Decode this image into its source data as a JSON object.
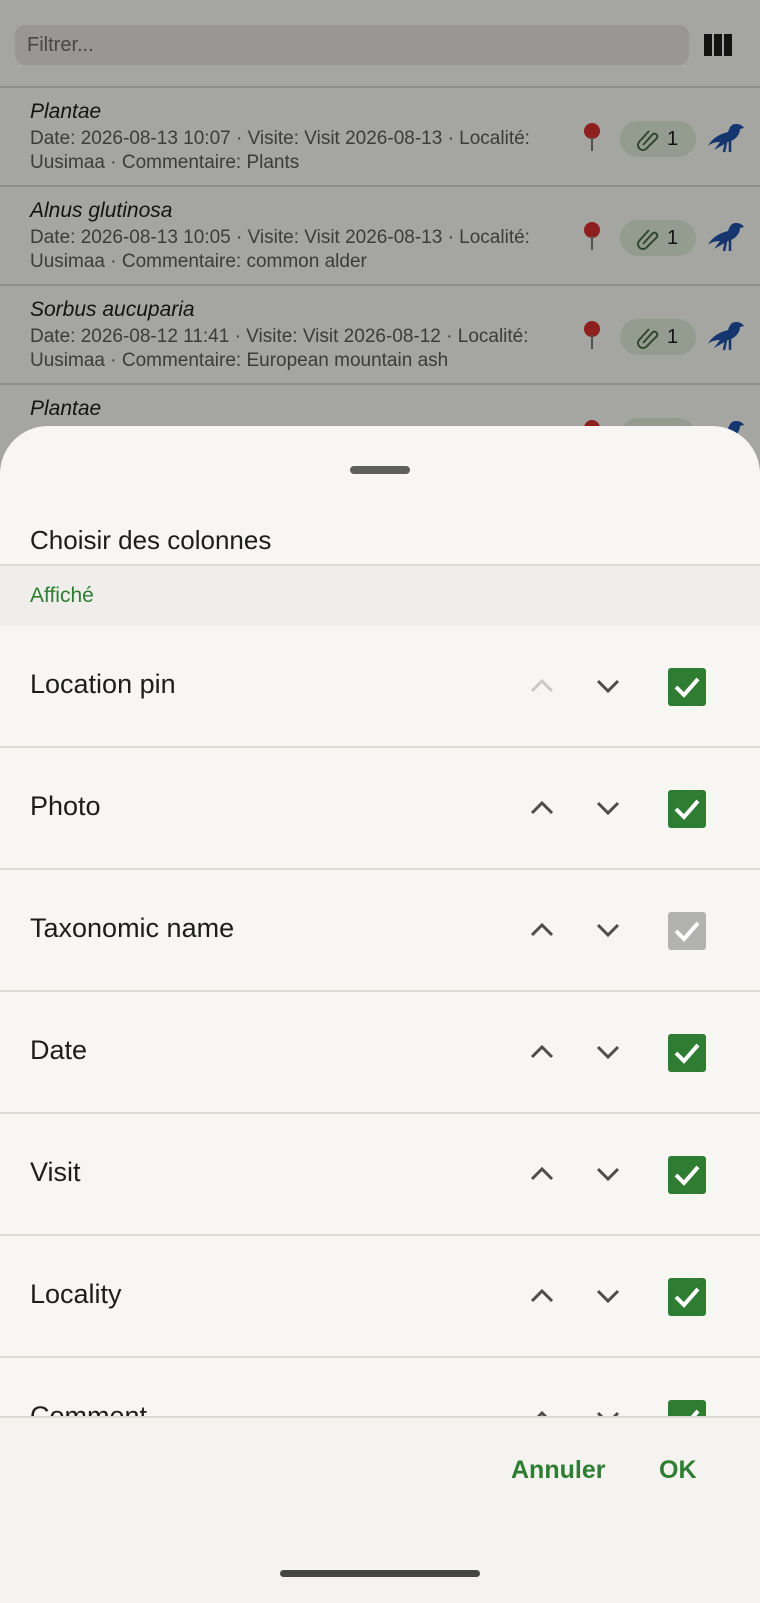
{
  "filter": {
    "placeholder": "Filtrer..."
  },
  "observations": [
    {
      "name": "Plantae",
      "line1": "Date: 2026-08-13 10:07  ·  Visite: Visit 2026-08-13  ·  Localité:",
      "line2": "Uusimaa  ·  Commentaire: Plants",
      "attachments": "1"
    },
    {
      "name": "Alnus glutinosa",
      "line1": "Date: 2026-08-13 10:05  ·  Visite: Visit 2026-08-13  ·  Localité:",
      "line2": "Uusimaa  ·  Commentaire: common alder",
      "attachments": "1"
    },
    {
      "name": "Sorbus aucuparia",
      "line1": "Date: 2026-08-12 11:41  ·  Visite: Visit 2026-08-12  ·  Localité:",
      "line2": "Uusimaa  ·  Commentaire: European mountain ash",
      "attachments": "1"
    },
    {
      "name": "Plantae",
      "line1": "",
      "line2": "",
      "attachments": ""
    }
  ],
  "dialog": {
    "title": "Choisir des colonnes",
    "section": "Affiché",
    "columns": [
      {
        "label": "Location pin",
        "checked": true,
        "up_enabled": false
      },
      {
        "label": "Photo",
        "checked": true,
        "up_enabled": true
      },
      {
        "label": "Taxonomic name",
        "checked": true,
        "disabled": true,
        "up_enabled": true
      },
      {
        "label": "Date",
        "checked": true,
        "up_enabled": true
      },
      {
        "label": "Visit",
        "checked": true,
        "up_enabled": true
      },
      {
        "label": "Locality",
        "checked": true,
        "up_enabled": true
      },
      {
        "label": "Comment",
        "checked": true,
        "up_enabled": true
      }
    ],
    "cancel_label": "Annuler",
    "ok_label": "OK"
  },
  "colors": {
    "accent": "#2e7d32",
    "bird": "#1f4fa3",
    "pin": "#d32f2f"
  },
  "icons": [
    "columns-icon",
    "location-pin-icon",
    "paperclip-icon",
    "bird-icon",
    "chevron-up-icon",
    "chevron-down-icon",
    "check-icon"
  ]
}
